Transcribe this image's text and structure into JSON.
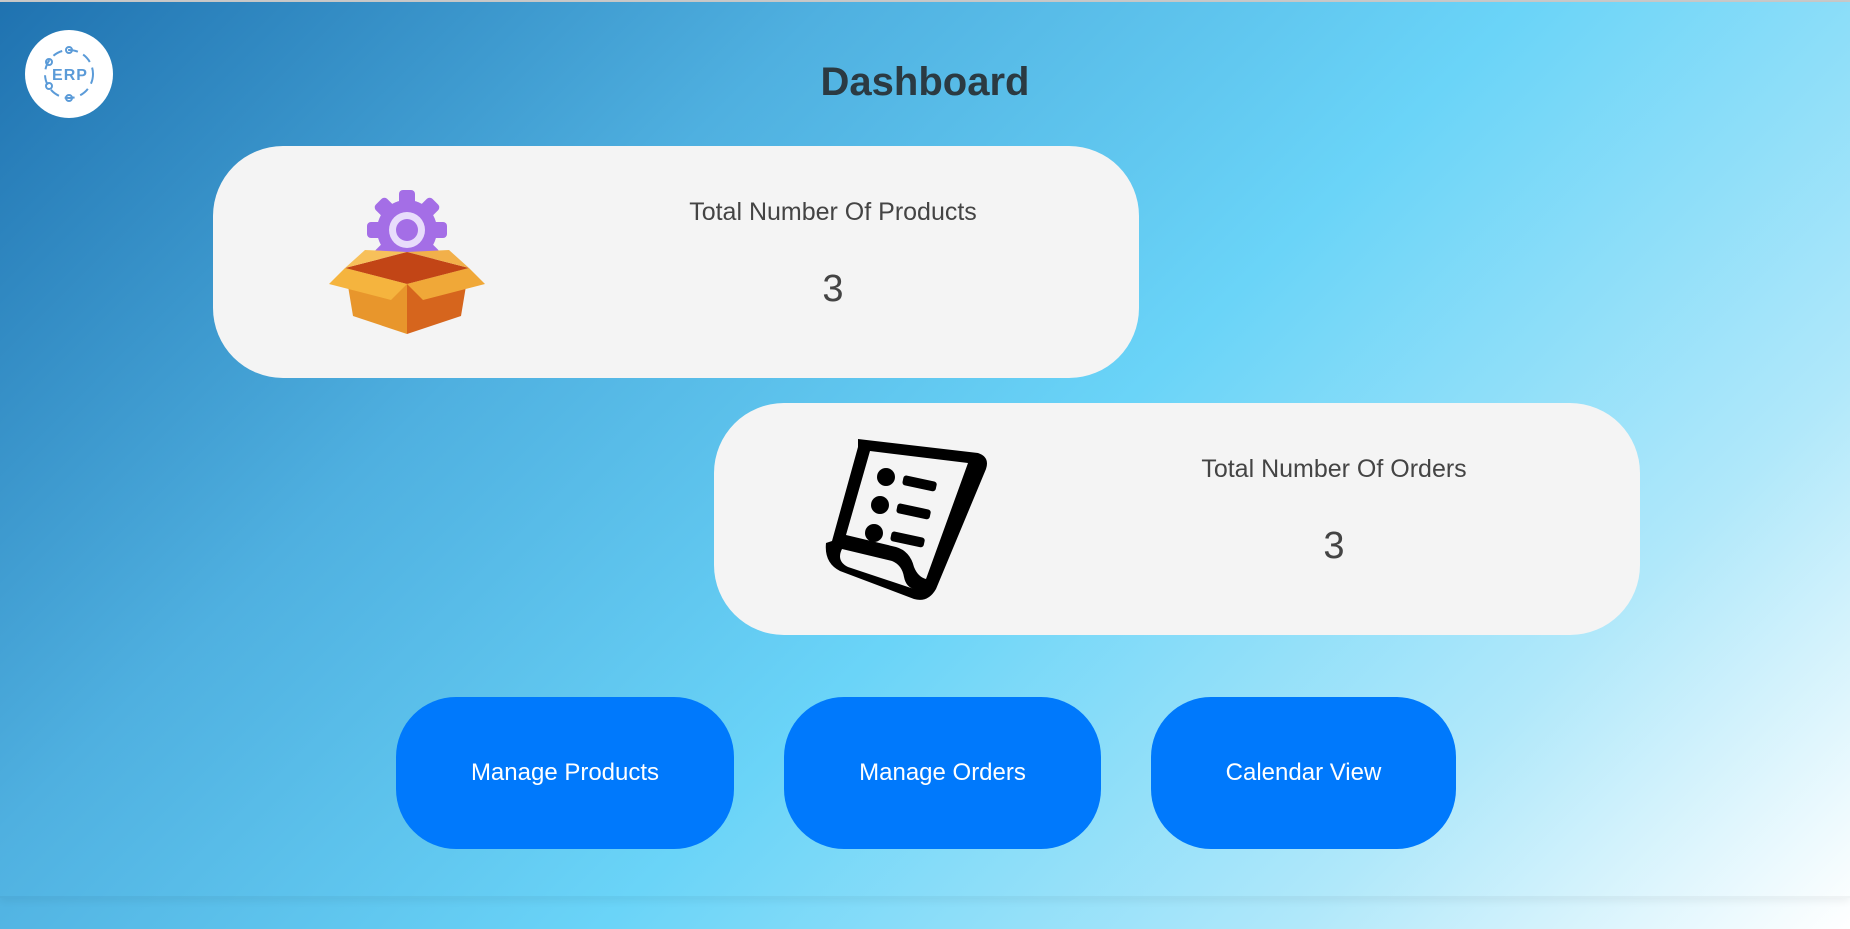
{
  "logo": {
    "text": "ERP",
    "icon": "erp-logo"
  },
  "header": {
    "title": "Dashboard"
  },
  "cards": [
    {
      "label": "Total Number Of Products",
      "value": "3",
      "icon": "box-gear-icon"
    },
    {
      "label": "Total Number Of Orders",
      "value": "3",
      "icon": "receipt-list-icon"
    }
  ],
  "buttons": {
    "manage_products": "Manage Products",
    "manage_orders": "Manage Orders",
    "calendar_view": "Calendar View"
  },
  "colors": {
    "button": "#0079fc",
    "card": "#f4f4f4",
    "title": "#2b3a42"
  }
}
